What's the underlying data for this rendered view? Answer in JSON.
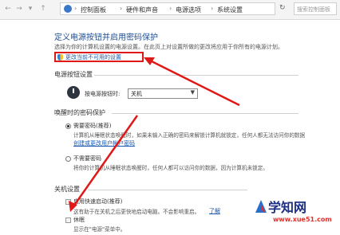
{
  "address_bar": {
    "breadcrumbs": [
      "控制面板",
      "硬件和声音",
      "电源选项",
      "系统设置"
    ],
    "search_placeholder": "搜索控制面板"
  },
  "page": {
    "title": "定义电源按钮并启用密码保护",
    "description": "选择为你的计算机设置的电源设置。在此页上对设置所做的更改将应用于你所有的电源计划。",
    "change_unavailable_link": "更改当前不可用的设置"
  },
  "power_button_section": {
    "heading": "电源按钮设置",
    "press_label": "按电源按钮时:",
    "press_value": "关机"
  },
  "password_section": {
    "heading": "唤醒时的密码保护",
    "require_label": "需要密码(推荐)",
    "require_desc_1": "计算机从睡眠状态唤醒时，如果未输入正确的密码来解锁计算机就锁定，任何人都无法访问你的数据",
    "require_link": "创建或更改用户帐户密码",
    "no_require_label": "不需要密码",
    "no_require_desc": "将你的计算机从睡眠状态唤醒时，任何人都可以访问你的数据，因为计算机未锁定。"
  },
  "shutdown_section": {
    "heading": "关机设置",
    "fast_startup_label": "启用快速启动(推荐)",
    "fast_startup_desc": "这有助于在关机之后更快地启动电脑。不会影响重启。",
    "fast_startup_link": "了解",
    "hibernate_label": "休眠",
    "hibernate_desc": "显示在\"电源\"菜单中。"
  },
  "watermark": {
    "brand": "学知网",
    "url": "www.xue51.com"
  },
  "colors": {
    "link": "#1a58b0",
    "title": "#1f4e92",
    "highlight": "#e01818"
  }
}
